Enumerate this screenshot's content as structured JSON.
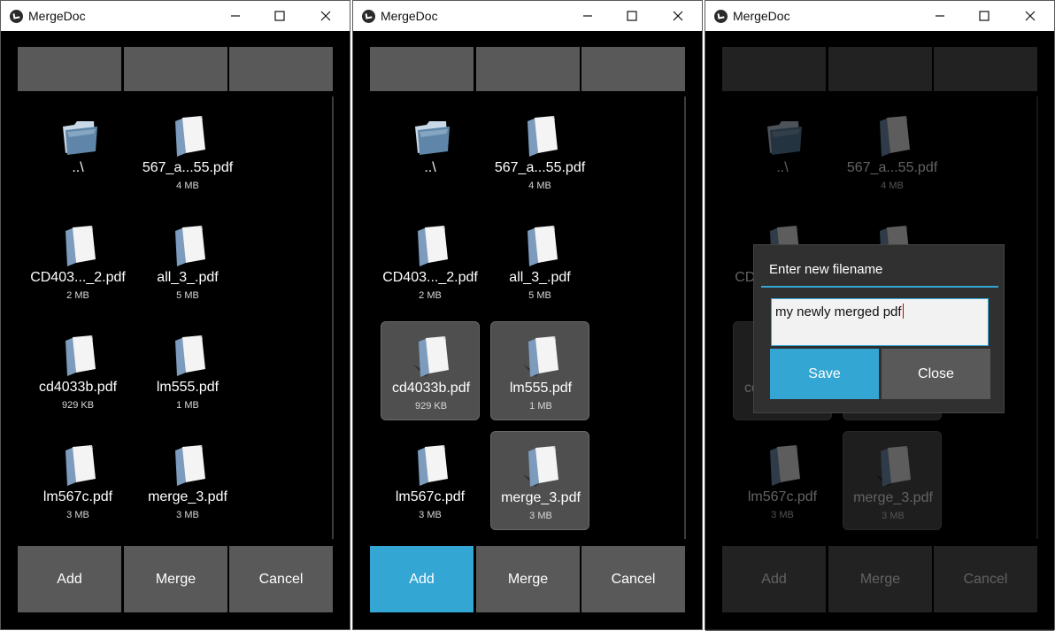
{
  "app_title": "MergeDoc",
  "files": [
    {
      "name": "..\\",
      "size": "",
      "type": "folder"
    },
    {
      "name": "567_a...55.pdf",
      "size": "4 MB",
      "type": "file"
    },
    {
      "name": "CD403..._2.pdf",
      "size": "2 MB",
      "type": "file"
    },
    {
      "name": "all_3_.pdf",
      "size": "5 MB",
      "type": "file"
    },
    {
      "name": "cd4033b.pdf",
      "size": "929 KB",
      "type": "file"
    },
    {
      "name": "lm555.pdf",
      "size": "1 MB",
      "type": "file"
    },
    {
      "name": "lm567c.pdf",
      "size": "3 MB",
      "type": "file"
    },
    {
      "name": "merge_3.pdf",
      "size": "3 MB",
      "type": "file"
    }
  ],
  "buttons": {
    "add": "Add",
    "merge": "Merge",
    "cancel": "Cancel"
  },
  "dialog": {
    "title": "Enter new filename",
    "input_value": "my newly merged pdf",
    "save": "Save",
    "close": "Close"
  },
  "colors": {
    "accent": "#33a6d3",
    "button": "#595959",
    "background": "#000000"
  }
}
